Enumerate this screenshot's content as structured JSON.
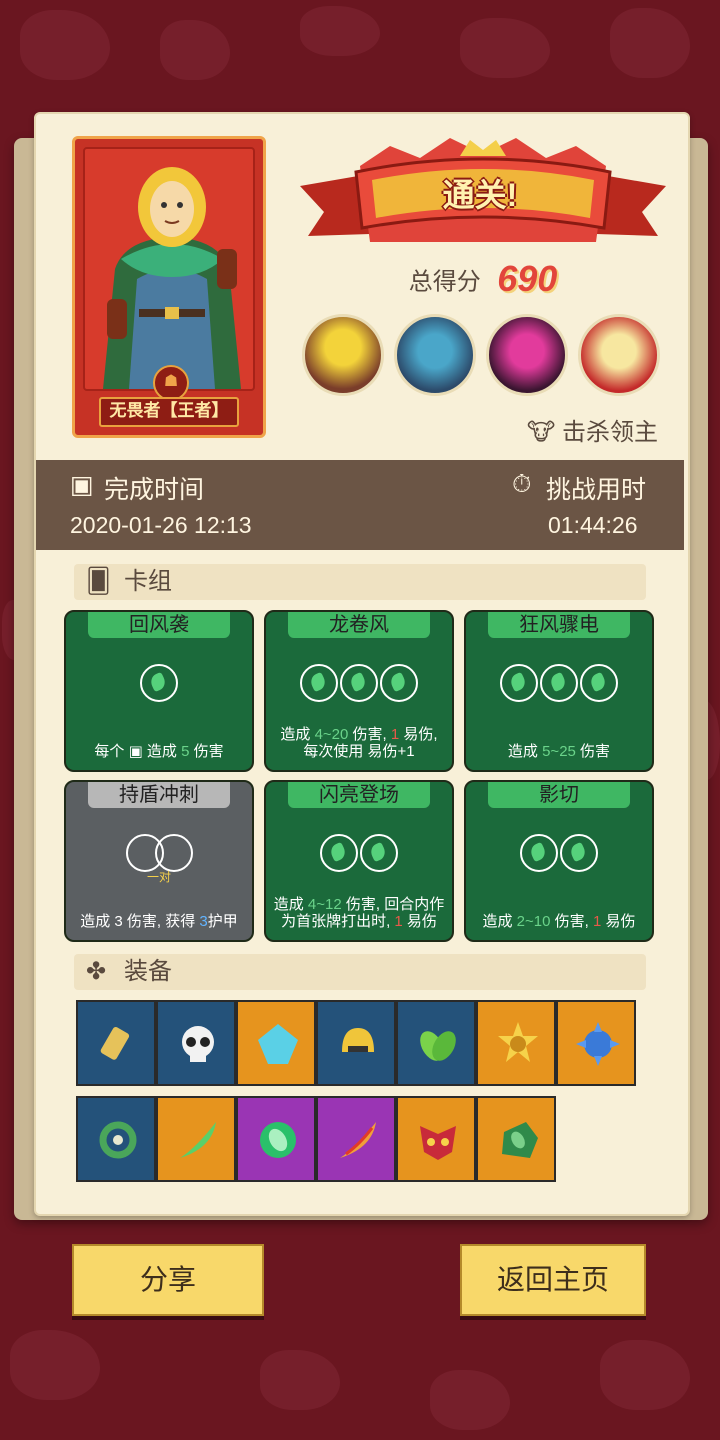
{
  "result": {
    "banner": "通关!",
    "score_label": "总得分",
    "score_value": "690",
    "hero_name": "无畏者【王者】",
    "kill_label": "击杀领主"
  },
  "bosses": [
    {
      "name": "boss-1",
      "colors": [
        "#f3d33a",
        "#7a3d2a"
      ]
    },
    {
      "name": "boss-2",
      "colors": [
        "#4aa6c9",
        "#2c4a6a"
      ]
    },
    {
      "name": "boss-3",
      "colors": [
        "#e23b9c",
        "#3a1530"
      ]
    },
    {
      "name": "boss-4",
      "colors": [
        "#f7e7a0",
        "#c42a2a"
      ]
    }
  ],
  "time": {
    "finish_label": "完成时间",
    "finish_value": "2020-01-26 12:13",
    "duration_label": "挑战用时",
    "duration_value": "01:44:26"
  },
  "deck": {
    "header": "卡组",
    "cards": [
      {
        "title": "回风袭",
        "theme": "green",
        "coins": 1,
        "desc_parts": [
          "每个 ",
          "▣",
          " 造成 ",
          "5",
          " 伤害"
        ]
      },
      {
        "title": "龙卷风",
        "theme": "green",
        "coins": 3,
        "desc_parts": [
          "造成 ",
          "4~20",
          " 伤害, ",
          "1",
          " 易伤, 每次使用 ",
          "易伤+1"
        ]
      },
      {
        "title": "狂风骤电",
        "theme": "green",
        "coins": 3,
        "desc_parts": [
          "造成 ",
          "5~25",
          " 伤害"
        ]
      },
      {
        "title": "持盾冲刺",
        "theme": "gray",
        "coins": 0,
        "pair_label": "一对",
        "desc_parts": [
          "造成 ",
          "3",
          " 伤害, 获得 ",
          "3",
          "护甲"
        ]
      },
      {
        "title": "闪亮登场",
        "theme": "green",
        "coins": 2,
        "desc_parts": [
          "造成 ",
          "4~12",
          " 伤害, 回合内作为首张牌打出时, ",
          "1",
          " 易伤"
        ]
      },
      {
        "title": "影切",
        "theme": "green",
        "coins": 2,
        "desc_parts": [
          "造成 ",
          "2~10",
          " 伤害, ",
          "1",
          " 易伤"
        ]
      }
    ]
  },
  "equipment": {
    "header": "装备",
    "row1": [
      {
        "name": "scroll-charm",
        "bg": "blue"
      },
      {
        "name": "skull",
        "bg": "blue"
      },
      {
        "name": "crystal-mask",
        "bg": "orange"
      },
      {
        "name": "golden-helmet",
        "bg": "blue"
      },
      {
        "name": "green-leaves",
        "bg": "blue"
      },
      {
        "name": "sun-trophy-medal",
        "bg": "orange"
      },
      {
        "name": "spiked-orb",
        "bg": "orange"
      }
    ],
    "row2": [
      {
        "name": "vine-wreath",
        "bg": "blue"
      },
      {
        "name": "green-feather",
        "bg": "orange"
      },
      {
        "name": "leaf-emblem",
        "bg": "purple"
      },
      {
        "name": "fire-feather",
        "bg": "purple"
      },
      {
        "name": "demon-mask",
        "bg": "orange"
      },
      {
        "name": "jade-stone",
        "bg": "orange"
      }
    ]
  },
  "buttons": {
    "share": "分享",
    "home": "返回主页"
  },
  "colors": {
    "background": "#6a1620",
    "paper": "#f8f0d8",
    "time_band": "#6b5545",
    "score": "#e2453b",
    "card_green": "#1b6a3b",
    "button": "#f8d86a"
  }
}
